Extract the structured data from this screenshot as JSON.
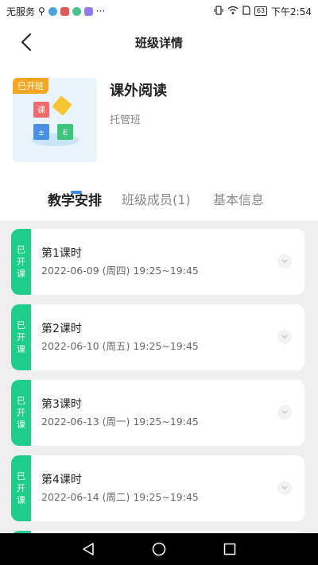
{
  "status_bar": {
    "carrier": "无服务",
    "battery": "63",
    "time": "下午2:54",
    "more": "···"
  },
  "header": {
    "title": "班级详情"
  },
  "course": {
    "badge": "已开班",
    "name": "课外阅读",
    "type": "托管班",
    "cover_glyphs": [
      "课",
      "±",
      "E"
    ]
  },
  "tabs": [
    {
      "label": "教学安排",
      "active": true
    },
    {
      "label": "班级成员(1)",
      "active": false
    },
    {
      "label": "基本信息",
      "active": false
    }
  ],
  "sessions": [
    {
      "badge": "已开课",
      "title": "第1课时",
      "time": "2022-06-09 (周四) 19:25~19:45"
    },
    {
      "badge": "已开课",
      "title": "第2课时",
      "time": "2022-06-10 (周五) 19:25~19:45"
    },
    {
      "badge": "已开课",
      "title": "第3课时",
      "time": "2022-06-13 (周一) 19:25~19:45"
    },
    {
      "badge": "已开课",
      "title": "第4课时",
      "time": "2022-06-14 (周二) 19:25~19:45"
    }
  ],
  "colors": {
    "accent": "#3c8ce7",
    "started_green": "#1ecd8a",
    "badge_orange": "#f5a623"
  }
}
